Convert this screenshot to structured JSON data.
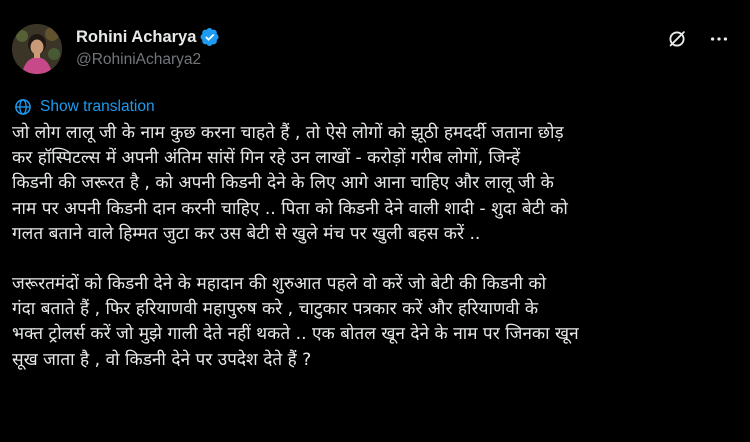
{
  "user": {
    "display_name": "Rohini Acharya",
    "handle": "@RohiniAcharya2",
    "verified": true
  },
  "actions": {
    "show_translation": "Show translation"
  },
  "icons": {
    "avatar": "profile-photo",
    "verified": "verified-badge-icon",
    "grok": "grok-icon",
    "more": "more-horizontal-icon",
    "translate": "globe-icon"
  },
  "colors": {
    "background": "#000000",
    "text": "#e7e9ea",
    "secondary": "#71767b",
    "accent": "#1d9bf0"
  },
  "tweet": {
    "paragraph1": [
      "जो लोग लालू जी के नाम कुछ करना चाहते हैं , तो ऐसे लोगों को झूठी हमदर्दी जताना छोड़",
      "कर हॉस्पिटल्स में अपनी अंतिम सांसें गिन रहे उन लाखों - करोड़ों गरीब लोगों, जिन्हें",
      "किडनी की जरूरत है , को अपनी किडनी देने के लिए आगे आना चाहिए और लालू जी के",
      "नाम पर अपनी किडनी दान करनी चाहिए .. पिता को किडनी देने वाली शादी - शुदा बेटी को",
      "गलत बताने वाले हिम्मत जुटा कर उस बेटी से खुले मंच पर खुली बहस करें .."
    ],
    "paragraph2": [
      "जरूरतमंदों  को किडनी देने के महादान की शुरुआत पहले वो करें जो बेटी की किडनी को",
      "गंदा बताते हैं , फिर हरियाणवी महापुरुष करे , चाटुकार पत्रकार करें और हरियाणवी के",
      "भक्त ट्रोलर्स करें जो मुझे गाली देते नहीं थकते .. एक बोतल खून देने के नाम पर जिनका खून",
      "सूख जाता है , वो किडनी देने पर उपदेश देते हैं ?"
    ]
  }
}
